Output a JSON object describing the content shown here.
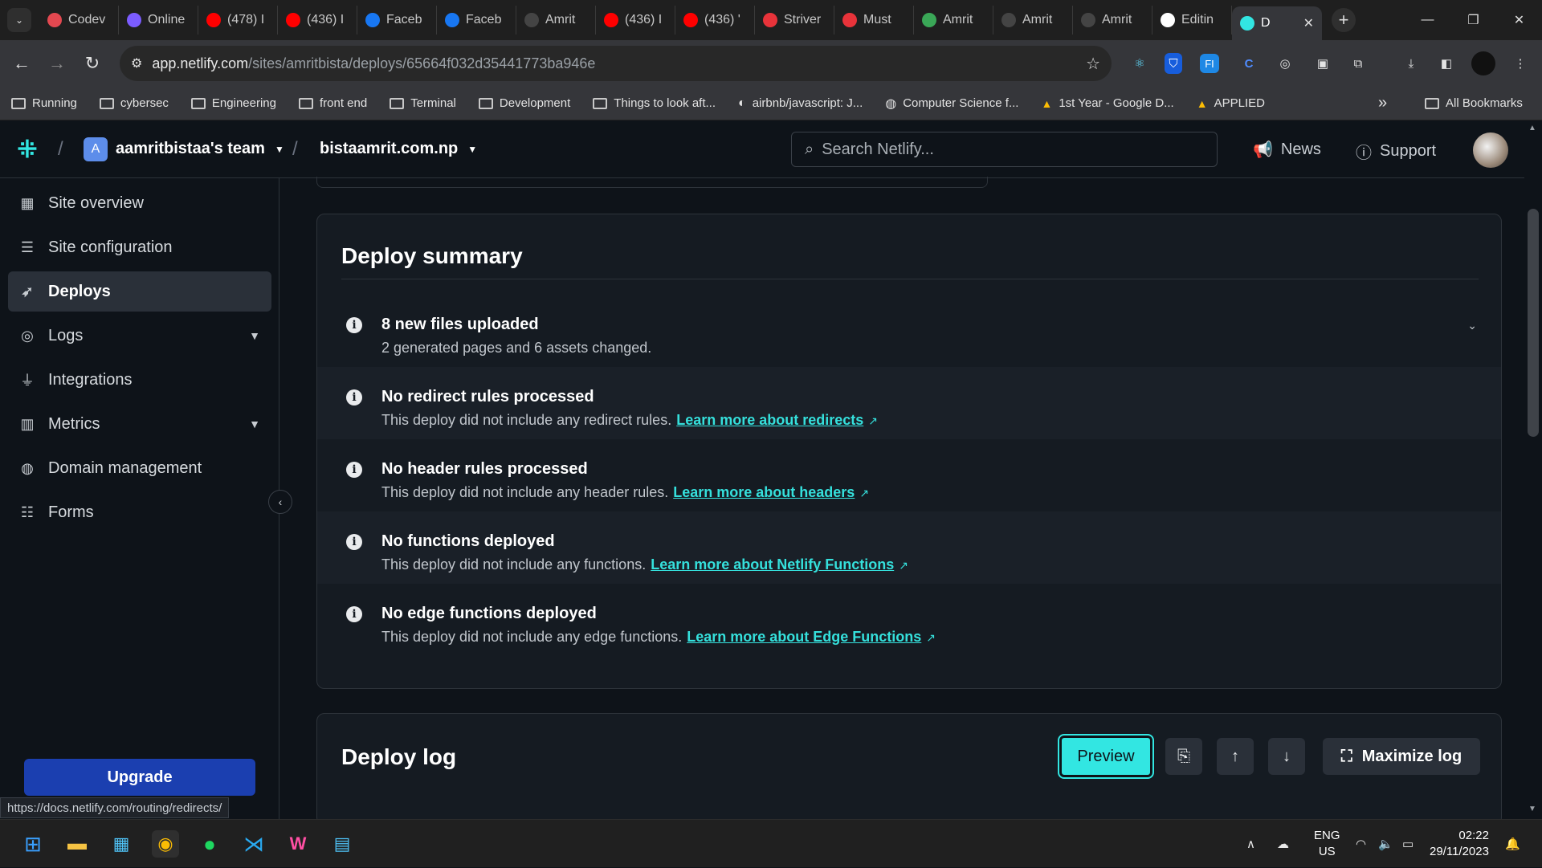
{
  "browser": {
    "tabs": [
      {
        "label": "Codev",
        "icon": "codeverse-icon",
        "color": "#e34850"
      },
      {
        "label": "Online",
        "icon": "online-icon",
        "color": "#7b5cff"
      },
      {
        "label": "(478) I",
        "icon": "youtube-icon",
        "color": "#ff0000"
      },
      {
        "label": "(436) I",
        "icon": "youtube-icon",
        "color": "#ff0000"
      },
      {
        "label": "Faceb",
        "icon": "facebook-icon",
        "color": "#1877f2"
      },
      {
        "label": "Faceb",
        "icon": "facebook-icon",
        "color": "#1877f2"
      },
      {
        "label": "Amrit",
        "icon": "amrit-icon",
        "color": "#444444"
      },
      {
        "label": "(436) I",
        "icon": "youtube-icon",
        "color": "#ff0000"
      },
      {
        "label": "(436) '",
        "icon": "youtube-icon",
        "color": "#ff0000"
      },
      {
        "label": "Striver",
        "icon": "striver-icon",
        "color": "#e8333a"
      },
      {
        "label": "Must",
        "icon": "striver-icon",
        "color": "#e8333a"
      },
      {
        "label": "Amrit",
        "icon": "leaf-icon",
        "color": "#3aa757"
      },
      {
        "label": "Amrit",
        "icon": "amrit-icon",
        "color": "#444444"
      },
      {
        "label": "Amrit",
        "icon": "amrit-icon",
        "color": "#444444"
      },
      {
        "label": "Editin",
        "icon": "github-icon",
        "color": "#ffffff"
      }
    ],
    "active_tab": {
      "label": "D",
      "icon": "netlify-icon"
    },
    "url_host": "app.netlify.com",
    "url_path": "/sites/amritbista/deploys/65664f032d35441773ba946e",
    "bookmarks": [
      {
        "label": "Running",
        "icon": "folder-icon"
      },
      {
        "label": "cybersec",
        "icon": "folder-icon"
      },
      {
        "label": "Engineering",
        "icon": "folder-icon"
      },
      {
        "label": "front end",
        "icon": "folder-icon"
      },
      {
        "label": "Terminal",
        "icon": "folder-icon"
      },
      {
        "label": "Development",
        "icon": "folder-icon"
      },
      {
        "label": "Things to look aft...",
        "icon": "folder-icon"
      },
      {
        "label": "airbnb/javascript: J...",
        "icon": "github-icon"
      },
      {
        "label": "Computer Science f...",
        "icon": "globe-icon"
      },
      {
        "label": "1st Year - Google D...",
        "icon": "drive-icon"
      },
      {
        "label": "APPLIED",
        "icon": "drive-icon"
      }
    ],
    "all_bookmarks": "All Bookmarks",
    "status_url": "https://docs.netlify.com/routing/redirects/"
  },
  "header": {
    "team_initial": "A",
    "team": "aamritbistaa's team",
    "site": "bistaamrit.com.np",
    "search_placeholder": "Search Netlify...",
    "news": "News",
    "support": "Support"
  },
  "sidebar": {
    "items": [
      {
        "label": "Site overview",
        "icon": "grid-icon"
      },
      {
        "label": "Site configuration",
        "icon": "config-icon"
      },
      {
        "label": "Deploys",
        "icon": "rocket-icon"
      },
      {
        "label": "Logs",
        "icon": "logs-icon"
      },
      {
        "label": "Integrations",
        "icon": "plug-icon"
      },
      {
        "label": "Metrics",
        "icon": "bar-chart-icon"
      },
      {
        "label": "Domain management",
        "icon": "globe-icon"
      },
      {
        "label": "Forms",
        "icon": "forms-icon"
      }
    ],
    "upgrade": "Upgrade"
  },
  "summary": {
    "title": "Deploy summary",
    "rows": [
      {
        "title": "8 new files uploaded",
        "desc": "2 generated pages and 6 assets changed.",
        "link": ""
      },
      {
        "title": "No redirect rules processed",
        "desc": "This deploy did not include any redirect rules.",
        "link": "Learn more about redirects"
      },
      {
        "title": "No header rules processed",
        "desc": "This deploy did not include any header rules.",
        "link": "Learn more about headers"
      },
      {
        "title": "No functions deployed",
        "desc": "This deploy did not include any functions.",
        "link": "Learn more about Netlify Functions"
      },
      {
        "title": "No edge functions deployed",
        "desc": "This deploy did not include any edge functions.",
        "link": "Learn more about Edge Functions"
      }
    ]
  },
  "log": {
    "title": "Deploy log",
    "preview": "Preview",
    "maximize": "Maximize log"
  },
  "taskbar": {
    "lang1": "ENG",
    "lang2": "US",
    "time": "02:22",
    "date": "29/11/2023"
  },
  "colors": {
    "accent": "#32e6e2",
    "upgrade": "#1b3fb0",
    "background": "#0e1319"
  }
}
